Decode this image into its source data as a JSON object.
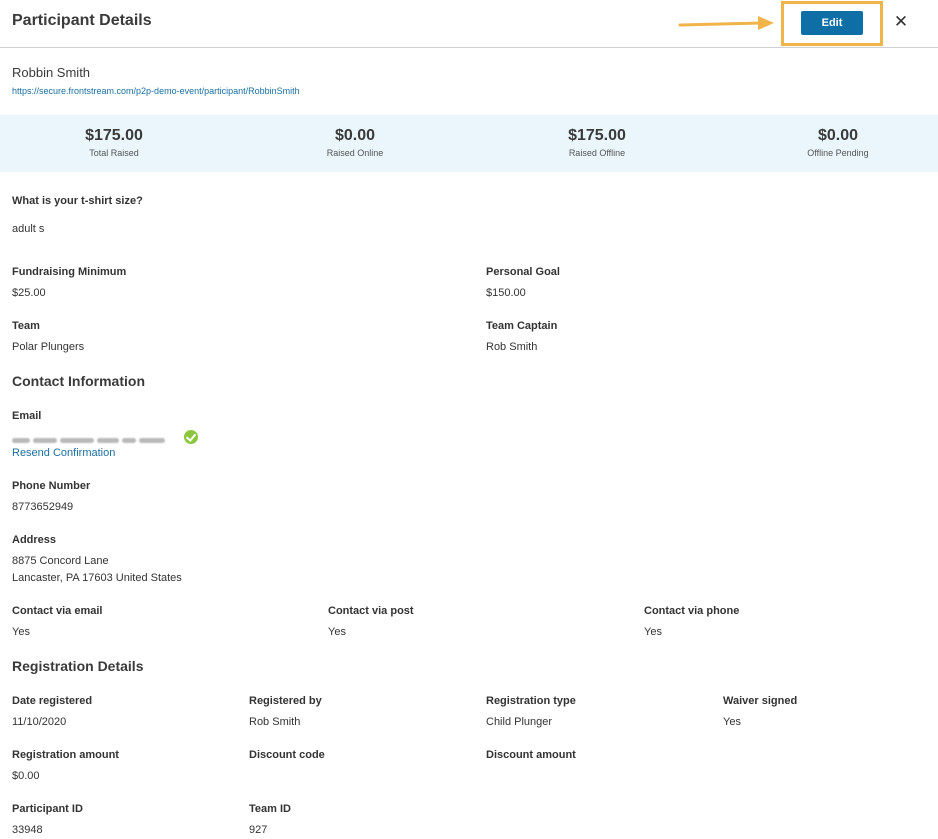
{
  "header": {
    "title": "Participant Details",
    "edit_label": "Edit",
    "close_glyph": "✕"
  },
  "participant": {
    "name": "Robbin Smith",
    "url": "https://secure.frontstream.com/p2p-demo-event/participant/RobbinSmith"
  },
  "stats": [
    {
      "value": "$175.00",
      "label": "Total Raised"
    },
    {
      "value": "$0.00",
      "label": "Raised Online"
    },
    {
      "value": "$175.00",
      "label": "Raised Offline"
    },
    {
      "value": "$0.00",
      "label": "Offline Pending"
    }
  ],
  "tshirt": {
    "label": "What is your t-shirt size?",
    "value": "adult s"
  },
  "fundraising": {
    "min_label": "Fundraising Minimum",
    "min_value": "$25.00",
    "goal_label": "Personal Goal",
    "goal_value": "$150.00",
    "team_label": "Team",
    "team_value": "Polar Plungers",
    "captain_label": "Team Captain",
    "captain_value": "Rob Smith"
  },
  "contact": {
    "title": "Contact Information",
    "email_label": "Email",
    "resend_label": "Resend Confirmation",
    "phone_label": "Phone Number",
    "phone_value": "8773652949",
    "address_label": "Address",
    "address_line1": "8875 Concord Lane",
    "address_line2": "Lancaster, PA 17603 United States",
    "via_email_label": "Contact via email",
    "via_email_value": "Yes",
    "via_post_label": "Contact via post",
    "via_post_value": "Yes",
    "via_phone_label": "Contact via phone",
    "via_phone_value": "Yes"
  },
  "registration": {
    "title": "Registration Details",
    "date_label": "Date registered",
    "date_value": "11/10/2020",
    "by_label": "Registered by",
    "by_value": "Rob Smith",
    "type_label": "Registration type",
    "type_value": "Child Plunger",
    "waiver_label": "Waiver signed",
    "waiver_value": "Yes",
    "amount_label": "Registration amount",
    "amount_value": "$0.00",
    "discount_code_label": "Discount code",
    "discount_amount_label": "Discount amount",
    "participant_id_label": "Participant ID",
    "participant_id_value": "33948",
    "team_id_label": "Team ID",
    "team_id_value": "927"
  },
  "colors": {
    "accent": "#0e6fa6",
    "highlight": "#f0b44a",
    "stats_bg": "#eaf6fb",
    "verified": "#8cc63f",
    "link": "#1a6fa0"
  },
  "icons": {
    "close": "close-icon",
    "verified": "check-circle-icon",
    "annotation": "arrow-icon"
  }
}
